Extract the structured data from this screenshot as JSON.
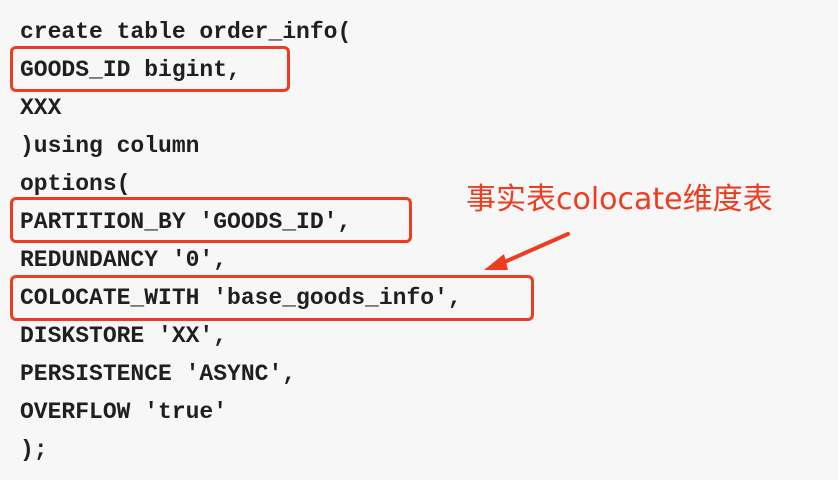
{
  "code": {
    "lines": [
      "create table order_info(",
      "GOODS_ID bigint,",
      "XXX",
      ")using column",
      "options(",
      "PARTITION_BY 'GOODS_ID',",
      "REDUNDANCY '0',",
      "COLOCATE_WITH 'base_goods_info',",
      "DISKSTORE 'XX',",
      "PERSISTENCE 'ASYNC',",
      "OVERFLOW 'true'",
      ");"
    ]
  },
  "annotation": {
    "text": "事实表colocate维度表"
  },
  "colors": {
    "highlight": "#ee3c1f",
    "background": "#f7f7f7",
    "code_text": "#1f1f1f"
  }
}
